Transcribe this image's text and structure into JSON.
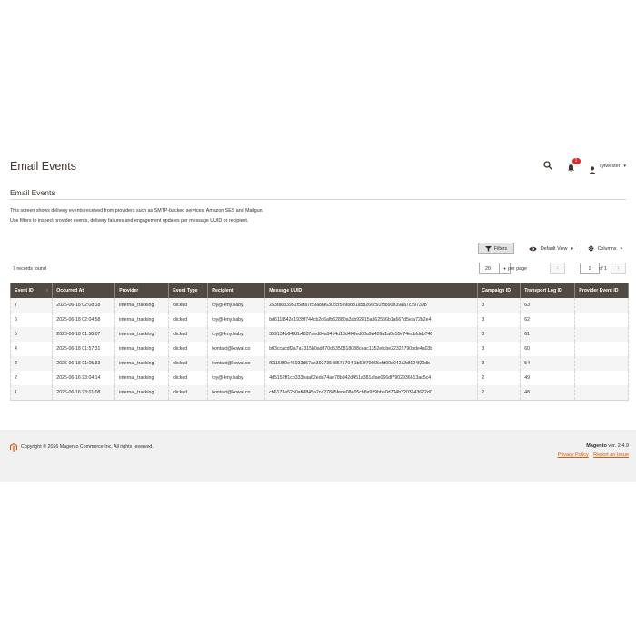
{
  "header": {
    "title": "Email Events",
    "notifications_count": "1",
    "user_name": "sylwester"
  },
  "section": {
    "title": "Email Events",
    "description_line1": "This screen shows delivery events received from providers such as SMTP-backed services, Amazon SES and Mailgun.",
    "description_line2": "Use filters to inspect provider events, delivery failures and engagement updates per message UUID or recipient."
  },
  "toolbar": {
    "filters_label": "Filters",
    "view_label": "Default View",
    "columns_label": "Columns",
    "records_found": "7 records found",
    "per_page_value": "20",
    "per_page_label": "per page",
    "current_page": "1",
    "page_of": "of 1"
  },
  "grid": {
    "columns": [
      "Event ID",
      "Occurred At",
      "Provider",
      "Event Type",
      "Recipient",
      "Message UUID",
      "Campaign ID",
      "Transport Log ID",
      "Provider Event ID"
    ],
    "sort_indicator": "↑",
    "rows": [
      [
        "7",
        "2026-06-18 02:08:18",
        "internal_tracking",
        "clicked",
        "toy@4my.baby",
        "253fa683951f5afa7f59a8f9630ccf5998d31a58266c91fd890e39aa7c29739b",
        "3",
        "63",
        ""
      ],
      [
        "6",
        "2026-06-18 02:04:58",
        "internal_tracking",
        "clicked",
        "toy@4my.baby",
        "bd611f842e1939f744cb2d6afb62880a3ab92815a362556b1a667d5efa72b2e4",
        "3",
        "62",
        ""
      ],
      [
        "5",
        "2026-06-18 01:58:07",
        "internal_tracking",
        "clicked",
        "toy@4my.baby",
        "359134b6492b4837aed84a9414d18d4f4fed00a9a426a1a0e55e74ecbfdeb748",
        "3",
        "61",
        ""
      ],
      [
        "4",
        "2026-06-18 01:57:31",
        "internal_tracking",
        "clicked",
        "kontakt@kowal.co",
        "b03ccacdf2a7a7315b0ad870d5350818088ceac1352efcbe22322790bde4a03b",
        "3",
        "60",
        ""
      ],
      [
        "3",
        "2026-06-18 01:05:33",
        "internal_tracking",
        "clicked",
        "kontakt@kowal.co",
        "f01156f9e46033d57ae39273548575704 1b53f70665efd90a042c2df124f20db",
        "3",
        "54",
        ""
      ],
      [
        "2",
        "2026-06-16 23:04:14",
        "internal_tracking",
        "clicked",
        "toy@4my.baby",
        "4d5152ff1cb333eaa62edd74ae78bd42d451a381afae066df7902936613ac5c4",
        "2",
        "49",
        ""
      ],
      [
        "1",
        "2026-06-16 23:01:08",
        "internal_tracking",
        "clicked",
        "kontakt@kowal.co",
        "cb6173a52b0af6f845a2ce278d5fede08e05cb8a929bbe0d704b2203643622d0",
        "2",
        "48",
        ""
      ]
    ]
  },
  "footer": {
    "copyright": "Copyright © 2026 Magento Commerce Inc. All rights reserved.",
    "brand": "Magento",
    "version": " ver. 2.4.9",
    "privacy_link": "Privacy Policy",
    "separator": "|",
    "report_link": "Report an Issue"
  },
  "colors": {
    "grid_header": "#514943",
    "accent": "#eb5202",
    "badge": "#e22626"
  },
  "icons": [
    "search-icon",
    "bell-icon",
    "user-icon",
    "filter-icon",
    "eye-icon",
    "cog-icon",
    "magento-logo-icon"
  ]
}
